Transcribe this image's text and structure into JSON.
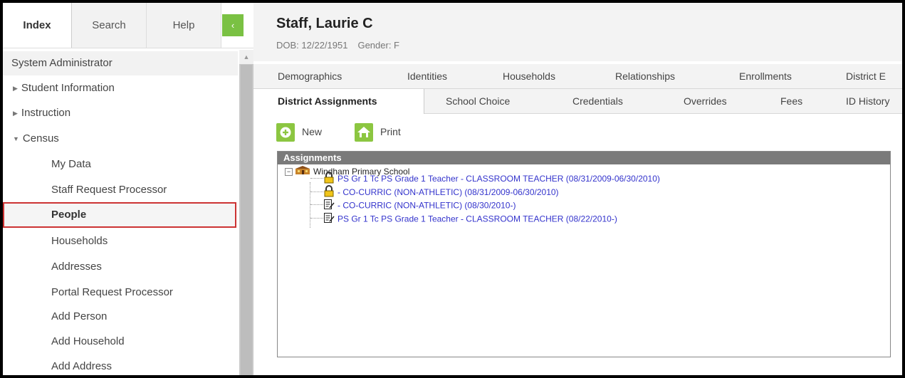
{
  "nav": {
    "tabs": [
      {
        "label": "Index",
        "active": true
      },
      {
        "label": "Search",
        "active": false
      },
      {
        "label": "Help",
        "active": false
      }
    ],
    "collapse_glyph": "‹",
    "role": "System Administrator",
    "items": [
      {
        "label": "Student Information",
        "level": 1,
        "expanded": false
      },
      {
        "label": "Instruction",
        "level": 1,
        "expanded": false
      },
      {
        "label": "Census",
        "level": 1,
        "expanded": true
      },
      {
        "label": "My Data",
        "level": 2
      },
      {
        "label": "Staff Request Processor",
        "level": 2
      },
      {
        "label": "People",
        "level": 2,
        "selected": true
      },
      {
        "label": "Households",
        "level": 2
      },
      {
        "label": "Addresses",
        "level": 2
      },
      {
        "label": "Portal Request Processor",
        "level": 2
      },
      {
        "label": "Add Person",
        "level": 2
      },
      {
        "label": "Add Household",
        "level": 2
      },
      {
        "label": "Add Address",
        "level": 2
      }
    ]
  },
  "person": {
    "name": "Staff, Laurie C",
    "dob": "DOB: 12/22/1951",
    "gender": "Gender: F"
  },
  "tabs_row1": [
    "Demographics",
    "Identities",
    "Households",
    "Relationships",
    "Enrollments",
    "District E"
  ],
  "tabs_row2": [
    "District Assignments",
    "School Choice",
    "Credentials",
    "Overrides",
    "Fees",
    "ID History"
  ],
  "toolbar": {
    "new_label": "New",
    "print_label": "Print"
  },
  "assignments": {
    "header": "Assignments",
    "school": "Windham Primary School",
    "entries": [
      {
        "text": "PS Gr 1 Tc PS Grade 1 Teacher - CLASSROOM TEACHER (08/31/2009-06/30/2010)",
        "icon": "lock-icon"
      },
      {
        "text": "- CO-CURRIC (NON-ATHLETIC) (08/31/2009-06/30/2010)",
        "icon": "lock-icon"
      },
      {
        "text": "- CO-CURRIC (NON-ATHLETIC) (08/30/2010-)",
        "icon": "edit-document-icon"
      },
      {
        "text": "PS Gr 1 Tc PS Grade 1 Teacher - CLASSROOM TEACHER (08/22/2010-)",
        "icon": "edit-document-icon"
      }
    ]
  },
  "colors": {
    "accent_green": "#7ac143",
    "link_blue": "#3333cc",
    "selected_border": "#cc3333",
    "panel_header": "#7a7a7a"
  }
}
